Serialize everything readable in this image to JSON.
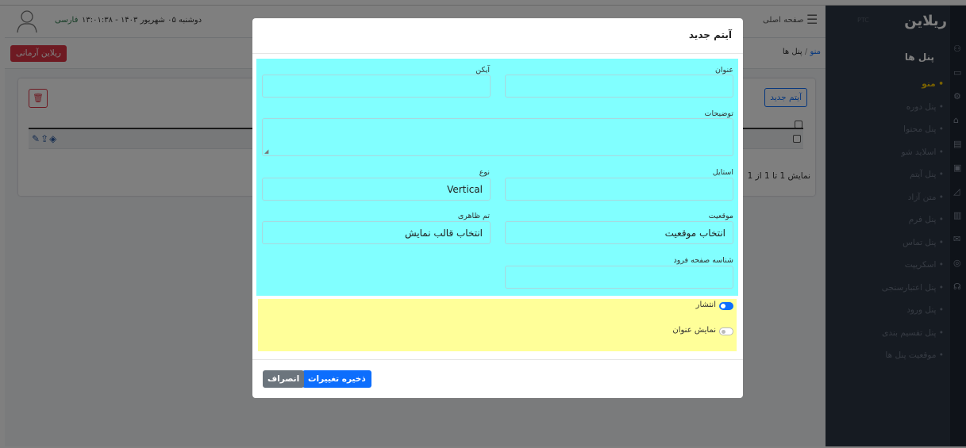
{
  "topbar": {
    "lang": "فارسی",
    "datetime": "دوشنبه ۰۵ شهریور ۱۴۰۳ - ۱۳:۰۱:۳۸",
    "home": "صفحه اصلی"
  },
  "subbar": {
    "store_button": "ریلاین آرمانی",
    "breadcrumb_parent": "پنل ها",
    "breadcrumb_sep": "/",
    "breadcrumb_current": "منو"
  },
  "card": {
    "add_button": "آیتم جدید",
    "showing": "نمایش 1 تا 1 از 1"
  },
  "sidebar": {
    "logo": "ریلاین",
    "logo_sub": "PTC",
    "title": "پنل ها",
    "items": [
      {
        "label": "منو",
        "active": true
      },
      {
        "label": "پنل دوره"
      },
      {
        "label": "پنل محتوا"
      },
      {
        "label": "اسلاید شو"
      },
      {
        "label": "پنل آیتم"
      },
      {
        "label": "متن آزاد"
      },
      {
        "label": "پنل فرم"
      },
      {
        "label": "پنل تماس"
      },
      {
        "label": "اسکریپت"
      },
      {
        "label": "پنل اعتبارسنجی"
      },
      {
        "label": "پنل ورود"
      },
      {
        "label": "پنل تقسیم بندی"
      },
      {
        "label": "موقعیت پنل ها"
      }
    ]
  },
  "modal": {
    "title": "آیتم جدید",
    "fields": {
      "title_label": "عنوان",
      "title_value": "",
      "icon_label": "آیکن",
      "icon_value": "",
      "description_label": "توضیحات",
      "description_value": "",
      "style_label": "استایل",
      "style_value": "",
      "type_label": "نوع",
      "type_value": "Vertical",
      "position_label": "موقعیت",
      "position_value": "انتخاب موقعیت",
      "theme_label": "تم ظاهری",
      "theme_value": "انتخاب قالب نمایش",
      "landing_label": "شناسه صفحه فرود",
      "landing_value": ""
    },
    "switches": {
      "publish_label": "انتشار",
      "publish_on": true,
      "show_title_label": "نمایش عنوان",
      "show_title_on": false
    },
    "footer": {
      "save": "ذخیره تغییرات",
      "cancel": "انصراف"
    }
  },
  "colors": {
    "form_highlight": "#81ffff",
    "switch_highlight": "#ffff99",
    "primary": "#0d6efd",
    "danger": "#dc3545",
    "sidebar_bg": "#2c3645",
    "active_menu": "#f5c400"
  }
}
